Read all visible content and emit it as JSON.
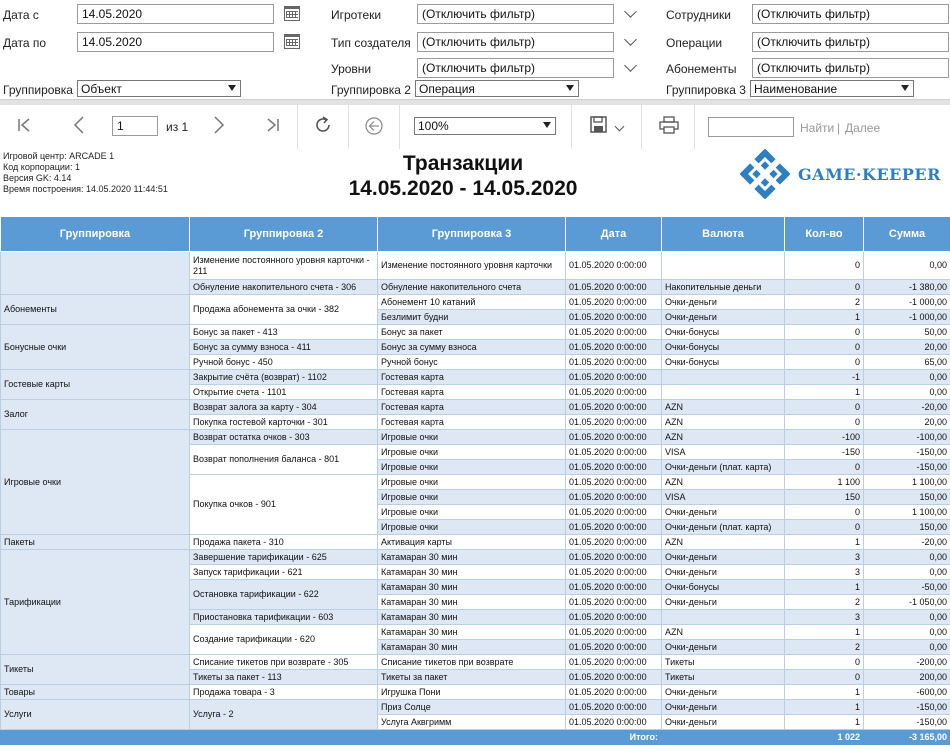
{
  "filters": {
    "date_from_label": "Дата с",
    "date_from": "14.05.2020",
    "date_to_label": "Дата по",
    "date_to": "14.05.2020",
    "grouping_label": "Группировка",
    "grouping": "Объект",
    "arcades_label": "Игротеки",
    "arcades": "(Отключить фильтр)",
    "creator_type_label": "Тип создателя",
    "creator_type": "(Отключить фильтр)",
    "levels_label": "Уровни",
    "levels": "(Отключить фильтр)",
    "grouping2_label": "Группировка 2",
    "grouping2": "Операция",
    "employees_label": "Сотрудники",
    "employees": "(Отключить фильтр)",
    "operations_label": "Операции",
    "operations": "(Отключить фильтр)",
    "subscriptions_label": "Абонементы",
    "subscriptions": "(Отключить фильтр)",
    "grouping3_label": "Группировка 3",
    "grouping3": "Наименование"
  },
  "toolbar": {
    "page": "1",
    "of_label": "из 1",
    "zoom": "100%",
    "find_label": "Найти",
    "next_label": "Далее",
    "sep": "|"
  },
  "report": {
    "meta": [
      "Игровой центр: ARCADE 1",
      "Код корпорации: 1",
      "Версия GK: 4.14",
      "Время построения: 14.05.2020 11:44:51"
    ],
    "title": "Транзакции",
    "period": "14.05.2020 - 14.05.2020",
    "logo_text": "GAME·KEEPER",
    "columns": [
      "Группировка",
      "Группировка 2",
      "Группировка 3",
      "Дата",
      "Валюта",
      "Кол-во",
      "Сумма"
    ],
    "rows": [
      [
        "",
        "Изменение постоянного уровня карточки - 211",
        "Изменение постоянного уровня карточки",
        "01.05.2020 0:00:00",
        "",
        "0",
        "0,00"
      ],
      [
        "",
        "Обнуление накопительного счета - 306",
        "Обнуление накопительного счета",
        "01.05.2020 0:00:00",
        "Накопительные деньги",
        "0",
        "-1 380,00"
      ],
      [
        "Абонементы",
        "Продажа абонемента за очки - 382",
        "Абонемент 10 катаний",
        "01.05.2020 0:00:00",
        "Очки-деньги",
        "2",
        "-1 000,00"
      ],
      [
        "",
        "",
        "Безлимит будни",
        "01.05.2020 0:00:00",
        "Очки-деньги",
        "1",
        "-1 000,00"
      ],
      [
        "Бонусные очки",
        "Бонус за пакет - 413",
        "Бонус за пакет",
        "01.05.2020 0:00:00",
        "Очки-бонусы",
        "0",
        "50,00"
      ],
      [
        "",
        "Бонус за сумму взноса - 411",
        "Бонус за сумму взноса",
        "01.05.2020 0:00:00",
        "Очки-бонусы",
        "0",
        "20,00"
      ],
      [
        "",
        "Ручной бонус - 450",
        "Ручной бонус",
        "01.05.2020 0:00:00",
        "Очки-бонусы",
        "0",
        "65,00"
      ],
      [
        "Гостевые карты",
        "Закрытие счёта (возврат) - 1102",
        "Гостевая карта",
        "01.05.2020 0:00:00",
        "",
        "-1",
        "0,00"
      ],
      [
        "",
        "Открытие счета - 1101",
        "Гостевая карта",
        "01.05.2020 0:00:00",
        "",
        "1",
        "0,00"
      ],
      [
        "Залог",
        "Возврат залога за карту - 304",
        "Гостевая карта",
        "01.05.2020 0:00:00",
        "AZN",
        "0",
        "-20,00"
      ],
      [
        "",
        "Покупка гостевой карточки - 301",
        "Гостевая карта",
        "01.05.2020 0:00:00",
        "AZN",
        "0",
        "20,00"
      ],
      [
        "Игровые очки",
        "Возврат остатка очков - 303",
        "Игровые очки",
        "01.05.2020 0:00:00",
        "AZN",
        "-100",
        "-100,00"
      ],
      [
        "",
        "Возврат пополнения баланса - 801",
        "Игровые очки",
        "01.05.2020 0:00:00",
        "VISA",
        "-150",
        "-150,00"
      ],
      [
        "",
        "",
        "Игровые очки",
        "01.05.2020 0:00:00",
        "Очки-деньги (плат. карта)",
        "0",
        "-150,00"
      ],
      [
        "",
        "Покупка очков - 901",
        "Игровые очки",
        "01.05.2020 0:00:00",
        "AZN",
        "1 100",
        "1 100,00"
      ],
      [
        "",
        "",
        "Игровые очки",
        "01.05.2020 0:00:00",
        "VISA",
        "150",
        "150,00"
      ],
      [
        "",
        "",
        "Игровые очки",
        "01.05.2020 0:00:00",
        "Очки-деньги",
        "0",
        "1 100,00"
      ],
      [
        "",
        "",
        "Игровые очки",
        "01.05.2020 0:00:00",
        "Очки-деньги (плат. карта)",
        "0",
        "150,00"
      ],
      [
        "Пакеты",
        "Продажа пакета - 310",
        "Активация карты",
        "01.05.2020 0:00:00",
        "AZN",
        "1",
        "-20,00"
      ],
      [
        "Тарификации",
        "Завершение тарификации - 625",
        "Катамаран 30 мин",
        "01.05.2020 0:00:00",
        "Очки-деньги",
        "3",
        "0,00"
      ],
      [
        "",
        "Запуск тарификации - 621",
        "Катамаран 30 мин",
        "01.05.2020 0:00:00",
        "Очки-деньги",
        "3",
        "0,00"
      ],
      [
        "",
        "Остановка тарификации - 622",
        "Катамаран 30 мин",
        "01.05.2020 0:00:00",
        "Очки-бонусы",
        "1",
        "-50,00"
      ],
      [
        "",
        "",
        "Катамаран 30 мин",
        "01.05.2020 0:00:00",
        "Очки-деньги",
        "2",
        "-1 050,00"
      ],
      [
        "",
        "Приостановка тарификации - 603",
        "Катамаран 30 мин",
        "01.05.2020 0:00:00",
        "",
        "3",
        "0,00"
      ],
      [
        "",
        "Создание тарификации - 620",
        "Катамаран 30 мин",
        "01.05.2020 0:00:00",
        "AZN",
        "1",
        "0,00"
      ],
      [
        "",
        "",
        "Катамаран 30 мин",
        "01.05.2020 0:00:00",
        "Очки-деньги",
        "2",
        "0,00"
      ],
      [
        "Тикеты",
        "Списание тикетов при возврате - 305",
        "Списание тикетов при возврате",
        "01.05.2020 0:00:00",
        "Тикеты",
        "0",
        "-200,00"
      ],
      [
        "",
        "Тикеты за пакет - 113",
        "Тикеты за пакет",
        "01.05.2020 0:00:00",
        "Тикеты",
        "0",
        "200,00"
      ],
      [
        "Товары",
        "Продажа товара - 3",
        "Игрушка Пони",
        "01.05.2020 0:00:00",
        "Очки-деньги",
        "1",
        "-600,00"
      ],
      [
        "Услуги",
        "Услуга - 2",
        "Приз Солце",
        "01.05.2020 0:00:00",
        "Очки-деньги",
        "1",
        "-150,00"
      ],
      [
        "",
        "",
        "Услуга Аквгримм",
        "01.05.2020 0:00:00",
        "Очки-деньги",
        "1",
        "-150,00"
      ]
    ],
    "total": {
      "label": "Итого:",
      "qty": "1 022",
      "sum": "-3 165,00"
    }
  }
}
